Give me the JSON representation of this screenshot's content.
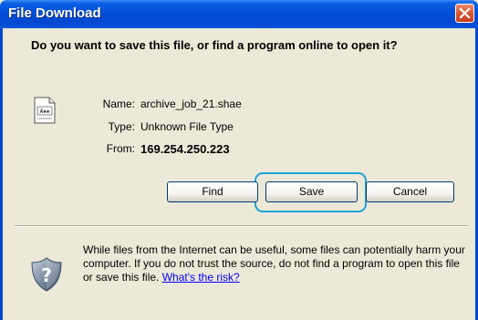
{
  "window": {
    "title": "File Download"
  },
  "dialog": {
    "question": "Do you want to save this file, or find a program online to open it?",
    "name_label": "Name:",
    "name_value": "archive_job_21.shae",
    "type_label": "Type:",
    "type_value": "Unknown File Type",
    "from_label": "From:",
    "from_value": "169.254.250.223"
  },
  "buttons": {
    "find": "Find",
    "save": "Save",
    "cancel": "Cancel"
  },
  "warning": {
    "text": "While files from the Internet can be useful, some files can potentially harm your computer. If you do not trust the source, do not find a program to open this file or save this file. ",
    "link": "What's the risk?"
  },
  "icons": {
    "close": "close-icon",
    "file": "file-icon",
    "warning": "security-shield-icon"
  },
  "colors": {
    "titlebar": "#0048cf",
    "dialog_bg": "#ece9d8",
    "close_button": "#d9582f",
    "focus_ring": "#1aa5d8",
    "link": "#0000ff"
  }
}
